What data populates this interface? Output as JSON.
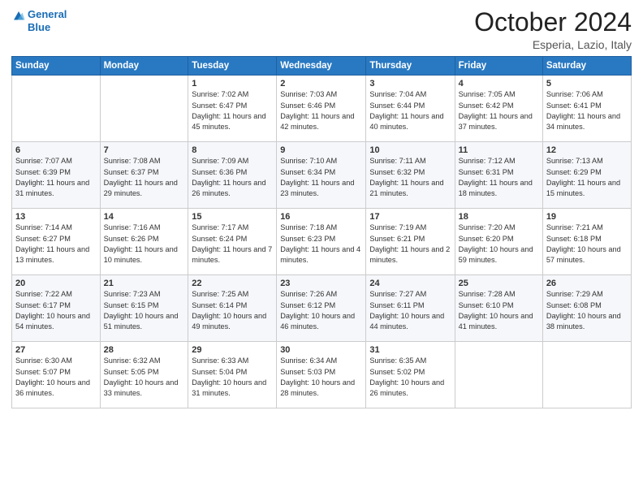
{
  "header": {
    "logo_line1": "General",
    "logo_line2": "Blue",
    "month": "October 2024",
    "location": "Esperia, Lazio, Italy"
  },
  "weekdays": [
    "Sunday",
    "Monday",
    "Tuesday",
    "Wednesday",
    "Thursday",
    "Friday",
    "Saturday"
  ],
  "rows": [
    [
      {
        "day": "",
        "info": ""
      },
      {
        "day": "",
        "info": ""
      },
      {
        "day": "1",
        "info": "Sunrise: 7:02 AM\nSunset: 6:47 PM\nDaylight: 11 hours and 45 minutes."
      },
      {
        "day": "2",
        "info": "Sunrise: 7:03 AM\nSunset: 6:46 PM\nDaylight: 11 hours and 42 minutes."
      },
      {
        "day": "3",
        "info": "Sunrise: 7:04 AM\nSunset: 6:44 PM\nDaylight: 11 hours and 40 minutes."
      },
      {
        "day": "4",
        "info": "Sunrise: 7:05 AM\nSunset: 6:42 PM\nDaylight: 11 hours and 37 minutes."
      },
      {
        "day": "5",
        "info": "Sunrise: 7:06 AM\nSunset: 6:41 PM\nDaylight: 11 hours and 34 minutes."
      }
    ],
    [
      {
        "day": "6",
        "info": "Sunrise: 7:07 AM\nSunset: 6:39 PM\nDaylight: 11 hours and 31 minutes."
      },
      {
        "day": "7",
        "info": "Sunrise: 7:08 AM\nSunset: 6:37 PM\nDaylight: 11 hours and 29 minutes."
      },
      {
        "day": "8",
        "info": "Sunrise: 7:09 AM\nSunset: 6:36 PM\nDaylight: 11 hours and 26 minutes."
      },
      {
        "day": "9",
        "info": "Sunrise: 7:10 AM\nSunset: 6:34 PM\nDaylight: 11 hours and 23 minutes."
      },
      {
        "day": "10",
        "info": "Sunrise: 7:11 AM\nSunset: 6:32 PM\nDaylight: 11 hours and 21 minutes."
      },
      {
        "day": "11",
        "info": "Sunrise: 7:12 AM\nSunset: 6:31 PM\nDaylight: 11 hours and 18 minutes."
      },
      {
        "day": "12",
        "info": "Sunrise: 7:13 AM\nSunset: 6:29 PM\nDaylight: 11 hours and 15 minutes."
      }
    ],
    [
      {
        "day": "13",
        "info": "Sunrise: 7:14 AM\nSunset: 6:27 PM\nDaylight: 11 hours and 13 minutes."
      },
      {
        "day": "14",
        "info": "Sunrise: 7:16 AM\nSunset: 6:26 PM\nDaylight: 11 hours and 10 minutes."
      },
      {
        "day": "15",
        "info": "Sunrise: 7:17 AM\nSunset: 6:24 PM\nDaylight: 11 hours and 7 minutes."
      },
      {
        "day": "16",
        "info": "Sunrise: 7:18 AM\nSunset: 6:23 PM\nDaylight: 11 hours and 4 minutes."
      },
      {
        "day": "17",
        "info": "Sunrise: 7:19 AM\nSunset: 6:21 PM\nDaylight: 11 hours and 2 minutes."
      },
      {
        "day": "18",
        "info": "Sunrise: 7:20 AM\nSunset: 6:20 PM\nDaylight: 10 hours and 59 minutes."
      },
      {
        "day": "19",
        "info": "Sunrise: 7:21 AM\nSunset: 6:18 PM\nDaylight: 10 hours and 57 minutes."
      }
    ],
    [
      {
        "day": "20",
        "info": "Sunrise: 7:22 AM\nSunset: 6:17 PM\nDaylight: 10 hours and 54 minutes."
      },
      {
        "day": "21",
        "info": "Sunrise: 7:23 AM\nSunset: 6:15 PM\nDaylight: 10 hours and 51 minutes."
      },
      {
        "day": "22",
        "info": "Sunrise: 7:25 AM\nSunset: 6:14 PM\nDaylight: 10 hours and 49 minutes."
      },
      {
        "day": "23",
        "info": "Sunrise: 7:26 AM\nSunset: 6:12 PM\nDaylight: 10 hours and 46 minutes."
      },
      {
        "day": "24",
        "info": "Sunrise: 7:27 AM\nSunset: 6:11 PM\nDaylight: 10 hours and 44 minutes."
      },
      {
        "day": "25",
        "info": "Sunrise: 7:28 AM\nSunset: 6:10 PM\nDaylight: 10 hours and 41 minutes."
      },
      {
        "day": "26",
        "info": "Sunrise: 7:29 AM\nSunset: 6:08 PM\nDaylight: 10 hours and 38 minutes."
      }
    ],
    [
      {
        "day": "27",
        "info": "Sunrise: 6:30 AM\nSunset: 5:07 PM\nDaylight: 10 hours and 36 minutes."
      },
      {
        "day": "28",
        "info": "Sunrise: 6:32 AM\nSunset: 5:05 PM\nDaylight: 10 hours and 33 minutes."
      },
      {
        "day": "29",
        "info": "Sunrise: 6:33 AM\nSunset: 5:04 PM\nDaylight: 10 hours and 31 minutes."
      },
      {
        "day": "30",
        "info": "Sunrise: 6:34 AM\nSunset: 5:03 PM\nDaylight: 10 hours and 28 minutes."
      },
      {
        "day": "31",
        "info": "Sunrise: 6:35 AM\nSunset: 5:02 PM\nDaylight: 10 hours and 26 minutes."
      },
      {
        "day": "",
        "info": ""
      },
      {
        "day": "",
        "info": ""
      }
    ]
  ]
}
